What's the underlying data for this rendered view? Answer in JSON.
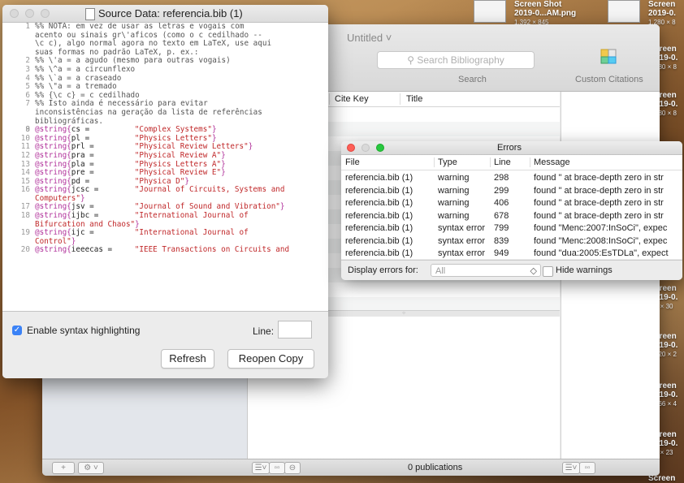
{
  "desktop": {
    "items": [
      {
        "line1": "Screen Shot",
        "line2": "2019-0...AM.png",
        "line3": "1.392 × 845"
      },
      {
        "line1": "Screen",
        "line2": "2019-0.",
        "line3": "1.280 × 8"
      },
      {
        "line1": "creen",
        "line2": "019-0.",
        "line3": "280 × 8"
      },
      {
        "line1": "creen",
        "line2": "019-0.",
        "line3": "280 × 8"
      },
      {
        "line1": "creen",
        "line2": "019-0.",
        "line3": "5 × 30"
      },
      {
        "line1": "creen",
        "line2": "019-0.",
        "line3": "020 × 2"
      },
      {
        "line1": "creen",
        "line2": "019-0.",
        "line3": "266 × 4"
      },
      {
        "line1": "creen",
        "line2": "019-0.",
        "line3": "0 × 23"
      },
      {
        "line1": "Screen",
        "line2": "",
        "line3": ""
      }
    ]
  },
  "main_window": {
    "title": "Untitled ˅",
    "search_placeholder": "Search Bibliography",
    "search_caption": "Search",
    "custom_citations": "Custom Citations",
    "columns": {
      "c0": ".",
      "cite_key": "Cite Key",
      "title": "Title"
    },
    "status": "0 publications",
    "add_btn": "+",
    "gear_btn": "⚙ ˅",
    "list_btn": "☰˅",
    "grid_btn": "▫▫",
    "link_btn": "⊖",
    "side_btn1": "☰˅",
    "side_btn2": "▫▫",
    "splitter_dot": "○"
  },
  "source_window": {
    "title": "Source Data: referencia.bib (1)",
    "lines": [
      {
        "n": "1",
        "t": "%% NOTA: em vez de usar as letras e vogais com",
        "k": "cm"
      },
      {
        "n": "",
        "t": "acento ou sinais gr\\'aficos (como o c cedilhado --",
        "k": "cm"
      },
      {
        "n": "",
        "t": "\\c c), algo normal agora no texto em LaTeX, use aqui",
        "k": "cm"
      },
      {
        "n": "",
        "t": "suas formas no padrão LaTeX, p. ex.:",
        "k": "cm"
      },
      {
        "n": "2",
        "t": "%% \\'a = a agudo (mesmo para outras vogais)",
        "k": "cm"
      },
      {
        "n": "3",
        "t": "%% \\^a = a circunflexo",
        "k": "cm"
      },
      {
        "n": "4",
        "t": "%% \\`a = a craseado",
        "k": "cm"
      },
      {
        "n": "5",
        "t": "%% \\\"a = a tremado",
        "k": "cm"
      },
      {
        "n": "6",
        "t": "%% {\\c c} = c cedilhado",
        "k": "cm"
      },
      {
        "n": "7",
        "t": "%% Isto ainda é necessário para evitar",
        "k": "cm"
      },
      {
        "n": "",
        "t": "inconsistências na geração da lista de referências",
        "k": "cm"
      },
      {
        "n": "",
        "t": "bibliográficas.",
        "k": "cm"
      },
      {
        "n": "8",
        "t": "",
        "k": "cm"
      },
      {
        "n": "9",
        "a": "@string{",
        "b": "cs =",
        "c": "\"Complex Systems\"",
        "d": "}"
      },
      {
        "n": "10",
        "a": "@string{",
        "b": "pl =",
        "c": "\"Physics Letters\"",
        "d": "}"
      },
      {
        "n": "11",
        "a": "@string{",
        "b": "prl =",
        "c": "\"Physical Review Letters\"",
        "d": "}"
      },
      {
        "n": "12",
        "a": "@string{",
        "b": "pra =",
        "c": "\"Physical Review A\"",
        "d": "}"
      },
      {
        "n": "13",
        "a": "@string{",
        "b": "pla =",
        "c": "\"Physics Letters A\"",
        "d": "}"
      },
      {
        "n": "14",
        "a": "@string{",
        "b": "pre =",
        "c": "\"Physical Review E\"",
        "d": "}"
      },
      {
        "n": "15",
        "a": "@string{",
        "b": "pd =",
        "c": "\"Physica D\"",
        "d": "}"
      },
      {
        "n": "16",
        "a": "@string{",
        "b": "jcsc =",
        "c": "\"Journal of Circuits, Systems and",
        "d": ""
      },
      {
        "n": "",
        "a": "",
        "b": "",
        "c": "Computers\"",
        "d": "}"
      },
      {
        "n": "17",
        "a": "@string{",
        "b": "jsv =",
        "c": "\"Journal of Sound and Vibration\"",
        "d": "}"
      },
      {
        "n": "18",
        "a": "@string{",
        "b": "ijbc =",
        "c": "\"International Journal of",
        "d": ""
      },
      {
        "n": "",
        "a": "",
        "b": "",
        "c": "Bifurcation and Chaos\"",
        "d": "}"
      },
      {
        "n": "19",
        "a": "@string{",
        "b": "ijc =",
        "c": "\"International Journal of",
        "d": ""
      },
      {
        "n": "",
        "a": "",
        "b": "",
        "c": "Control\"",
        "d": "}"
      },
      {
        "n": "20",
        "a": "@string{",
        "b": "ieeecas =",
        "c": "\"IEEE Transactions on Circuits and",
        "d": ""
      }
    ],
    "syntax_label": "Enable syntax highlighting",
    "syntax_checked": "✓",
    "line_label": "Line:",
    "line_value": "",
    "refresh": "Refresh",
    "reopen": "Reopen Copy"
  },
  "errors_window": {
    "title": "Errors",
    "headers": {
      "file": "File",
      "type": "Type",
      "line": "Line",
      "message": "Message"
    },
    "rows": [
      {
        "file": "referencia.bib (1)",
        "type": "warning",
        "line": "298",
        "message": "found \" at brace-depth zero in str"
      },
      {
        "file": "referencia.bib (1)",
        "type": "warning",
        "line": "299",
        "message": "found \" at brace-depth zero in str"
      },
      {
        "file": "referencia.bib (1)",
        "type": "warning",
        "line": "406",
        "message": "found \" at brace-depth zero in str"
      },
      {
        "file": "referencia.bib (1)",
        "type": "warning",
        "line": "678",
        "message": "found \" at brace-depth zero in str"
      },
      {
        "file": "referencia.bib (1)",
        "type": "syntax error",
        "line": "799",
        "message": "found \"Menc:2007:InSoCi\", expec"
      },
      {
        "file": "referencia.bib (1)",
        "type": "syntax error",
        "line": "839",
        "message": "found \"Menc:2008:InSoCi\", expec"
      },
      {
        "file": "referencia.bib (1)",
        "type": "syntax error",
        "line": "949",
        "message": "found \"dua:2005:EsTDLa\", expect"
      }
    ],
    "display_label": "Display errors for:",
    "display_value": "All",
    "display_chev": "◇",
    "hide_warnings": "Hide warnings"
  },
  "colors": {
    "accent": "#3b82f6",
    "close": "#fe5f57",
    "minimize": "#febc2e",
    "zoom": "#28c840",
    "comment": "#555555",
    "keyword": "#b0309a",
    "string": "#c0282a"
  }
}
